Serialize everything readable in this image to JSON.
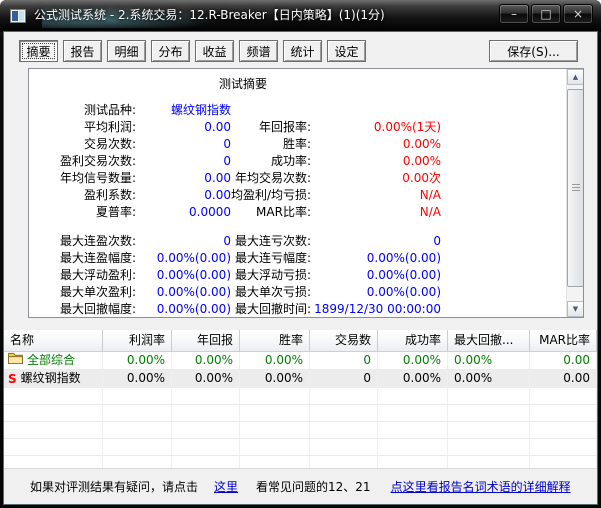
{
  "window": {
    "title": "公式测试系统 - 2.系统交易：12.R-Breaker【日内策略】(1)(1分)",
    "controls": {
      "minimize": "–",
      "maximize": "□",
      "close": "×"
    }
  },
  "tabs": [
    "摘要",
    "报告",
    "明细",
    "分布",
    "收益",
    "频谱",
    "统计",
    "设定"
  ],
  "active_tab_index": 0,
  "save_button": "保存(S)...",
  "summary": {
    "title": "测试摘要",
    "rows": [
      {
        "l1": "测试品种:",
        "v1": "螺纹钢指数",
        "c1": "blue",
        "l2": "",
        "v2": "",
        "c2": ""
      },
      {
        "l1": "平均利润:",
        "v1": "0.00",
        "c1": "blue",
        "l2": "年回报率:",
        "v2": "0.00%(1天)",
        "c2": "red"
      },
      {
        "l1": "交易次数:",
        "v1": "0",
        "c1": "blue",
        "l2": "胜率:",
        "v2": "0.00%",
        "c2": "red"
      },
      {
        "l1": "盈利交易次数:",
        "v1": "0",
        "c1": "blue",
        "l2": "成功率:",
        "v2": "0.00%",
        "c2": "red"
      },
      {
        "l1": "年均信号数量:",
        "v1": "0.00",
        "c1": "blue",
        "l2": "年均交易次数:",
        "v2": "0.00次",
        "c2": "red"
      },
      {
        "l1": "盈利系数:",
        "v1": "0.00",
        "c1": "blue",
        "l2": "均盈利/均亏损:",
        "v2": "N/A",
        "c2": "red"
      },
      {
        "l1": "夏普率:",
        "v1": "0.0000",
        "c1": "blue",
        "l2": "MAR比率:",
        "v2": "N/A",
        "c2": "red"
      },
      {
        "spacer": true
      },
      {
        "l1": "最大连盈次数:",
        "v1": "0",
        "c1": "blue",
        "l2": "最大连亏次数:",
        "v2": "0",
        "c2": "blue"
      },
      {
        "l1": "最大连盈幅度:",
        "v1": "0.00%(0.00)",
        "c1": "blue",
        "l2": "最大连亏幅度:",
        "v2": "0.00%(0.00)",
        "c2": "blue"
      },
      {
        "l1": "最大浮动盈利:",
        "v1": "0.00%(0.00)",
        "c1": "blue",
        "l2": "最大浮动亏损:",
        "v2": "0.00%(0.00)",
        "c2": "blue"
      },
      {
        "l1": "最大单次盈利:",
        "v1": "0.00%(0.00)",
        "c1": "blue",
        "l2": "最大单次亏损:",
        "v2": "0.00%(0.00)",
        "c2": "blue"
      },
      {
        "l1": "最大回撤幅度:",
        "v1": "0.00%(0.00)",
        "c1": "blue",
        "l2": "最大回撤时间:",
        "v2": "1899/12/30 00:00:00",
        "c2": "blue"
      }
    ]
  },
  "table": {
    "columns": [
      "名称",
      "利润率",
      "年回报",
      "胜率",
      "交易数",
      "成功率",
      "最大回撤...",
      "MAR比率"
    ],
    "rows": [
      {
        "icon": "folder-icon",
        "name": "全部综合",
        "values": [
          "0.00%",
          "0.00%",
          "0.00%",
          "0",
          "0.00%",
          "0.00%",
          "0.00"
        ]
      },
      {
        "icon": "s-icon",
        "name": "螺纹钢指数",
        "values": [
          "0.00%",
          "0.00%",
          "0.00%",
          "0",
          "0.00%",
          "0.00%",
          "0.00"
        ]
      }
    ]
  },
  "footer": {
    "text1": "如果对评测结果有疑问，请点击",
    "link1": "这里",
    "text2": "看常见问题的12、21",
    "link2": "点这里看报告名词术语的详细解释"
  },
  "icons": {
    "scroll_up": "▲",
    "scroll_down": "▼"
  },
  "colors": {
    "value_blue": "#0000ff",
    "value_red": "#ff0000",
    "row_green": "#008000",
    "link_blue": "#0000cc",
    "selected_row_bg": "#ececec"
  }
}
